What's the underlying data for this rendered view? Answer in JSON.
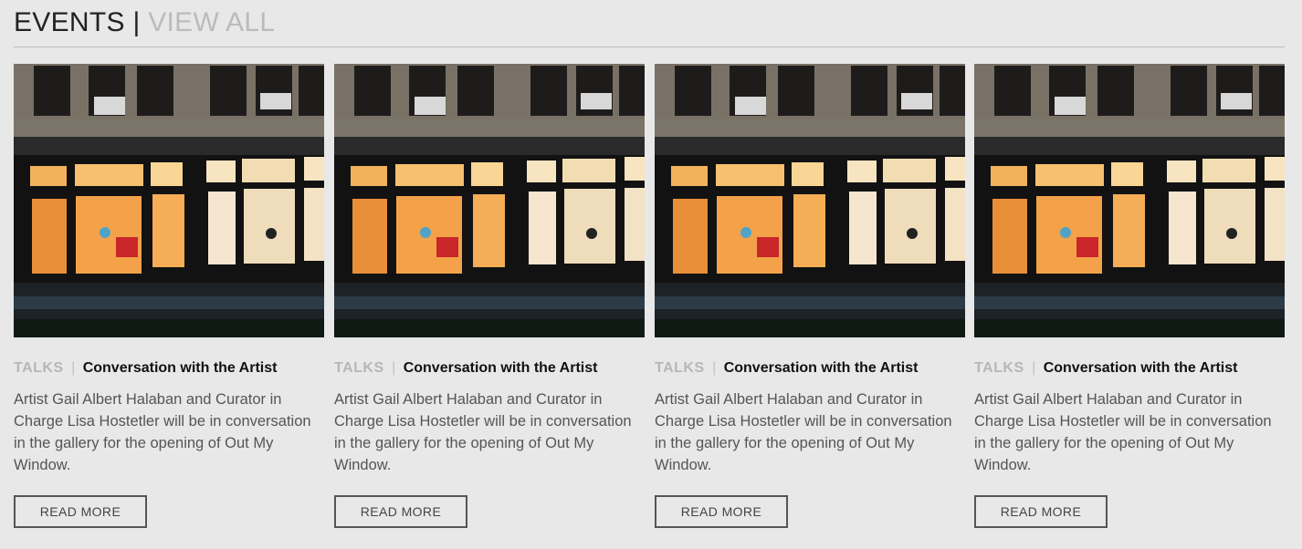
{
  "header": {
    "title": "EVENTS",
    "separator": "|",
    "view_all": "VIEW ALL"
  },
  "cards": [
    {
      "category": "TALKS",
      "separator": "|",
      "title": "Conversation with the Artist",
      "description": "Artist Gail Albert Halaban and Curator in Charge Lisa Hostetler will be in conversation in the gallery for the opening of Out My Window.",
      "button": "READ MORE"
    },
    {
      "category": "TALKS",
      "separator": "|",
      "title": "Conversation with the Artist",
      "description": "Artist Gail Albert Halaban and Curator in Charge Lisa Hostetler will be in conversation in the gallery for the opening of Out My Window.",
      "button": "READ MORE"
    },
    {
      "category": "TALKS",
      "separator": "|",
      "title": "Conversation with the Artist",
      "description": "Artist Gail Albert Halaban and Curator in Charge Lisa Hostetler will be in conversation in the gallery for the opening of Out My Window.",
      "button": "READ MORE"
    },
    {
      "category": "TALKS",
      "separator": "|",
      "title": "Conversation with the Artist",
      "description": "Artist Gail Albert Halaban and Curator in Charge Lisa Hostetler will be in conversation in the gallery for the opening of Out My Window.",
      "button": "READ MORE"
    }
  ]
}
